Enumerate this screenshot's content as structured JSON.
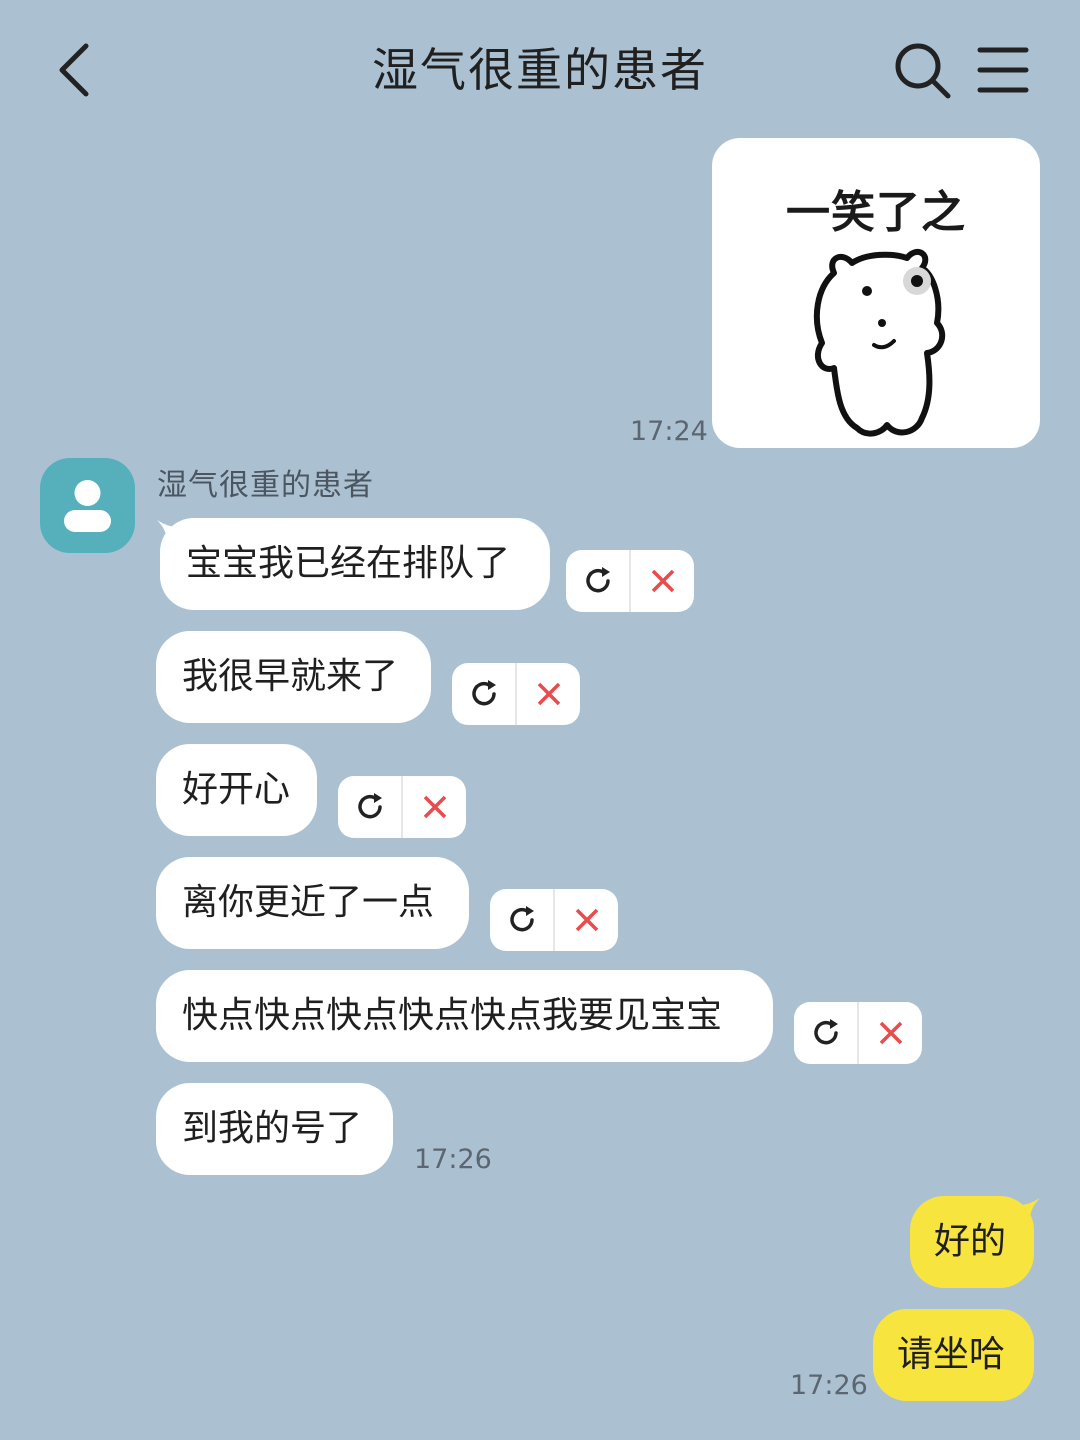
{
  "header": {
    "title": "湿气很重的患者"
  },
  "sticker": {
    "text": "一笑了之"
  },
  "times": {
    "t1": "17:24",
    "t2": "17:26",
    "t3": "17:26"
  },
  "contact": {
    "name": "湿气很重的患者"
  },
  "incoming": [
    {
      "text": "宝宝我已经在排队了",
      "failed": true
    },
    {
      "text": "我很早就来了",
      "failed": true
    },
    {
      "text": "好开心",
      "failed": true
    },
    {
      "text": "离你更近了一点",
      "failed": true
    },
    {
      "text": "快点快点快点快点快点我要见宝宝",
      "failed": true
    },
    {
      "text": "到我的号了",
      "failed": false
    }
  ],
  "outgoing": [
    {
      "text": "好的"
    },
    {
      "text": "请坐哈"
    }
  ],
  "icons": {
    "back": "chevron-left-icon",
    "search": "search-icon",
    "menu": "menu-icon",
    "retry": "refresh-icon",
    "delete": "close-icon",
    "avatar": "person-icon"
  },
  "colors": {
    "background": "#abc1d2",
    "incoming_bubble": "#ffffff",
    "outgoing_bubble": "#f8e43f",
    "avatar": "#56b0bb",
    "delete_icon": "#e84c4c"
  }
}
